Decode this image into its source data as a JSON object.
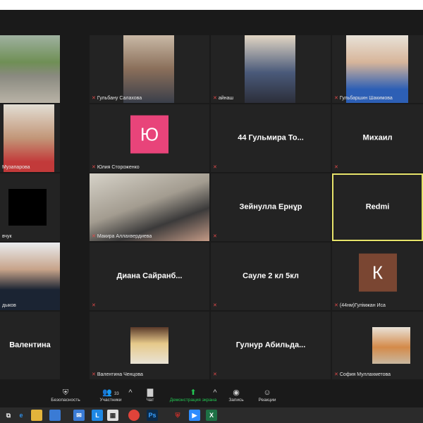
{
  "tiles": [
    {
      "label": ""
    },
    {
      "label": "Гульбану Салахова"
    },
    {
      "label": "айнаш"
    },
    {
      "label": "Гульбаршин Шакимова"
    },
    {
      "label": "Музапарова"
    },
    {
      "label": "Юлия Стороженко",
      "avatar": "Ю"
    },
    {
      "label": "",
      "big": "44 Гульмира То..."
    },
    {
      "label": "",
      "big": "Михаил"
    },
    {
      "label": "вчук"
    },
    {
      "label": "Макира Аллахвердиева"
    },
    {
      "label": "",
      "big": "Зейнулла Ернұр"
    },
    {
      "label": "",
      "big": "Redmi"
    },
    {
      "label": "дыков"
    },
    {
      "label": "",
      "big": "Диана  Сайранб..."
    },
    {
      "label": "",
      "big": "Сауле 2 кл 5кл"
    },
    {
      "label": "(44нм)Гулімжан Иса",
      "avatar": "К"
    },
    {
      "label": "",
      "big": "Валентина"
    },
    {
      "label": "Валентина Ченцова"
    },
    {
      "label": "",
      "big": "Гулнур  Абильда..."
    },
    {
      "label": "София Муллахметова"
    }
  ],
  "toolbar": {
    "security": "Безопасность",
    "participants": "Участники",
    "participants_count": "33",
    "chat": "Чат",
    "share": "Демонстрация экрана",
    "record": "Запись",
    "reactions": "Реакции"
  },
  "colors": {
    "avatar_pink": "#e8447a",
    "avatar_brown": "#7a4632",
    "active_border": "#e6e36a",
    "share_green": "#23c552"
  }
}
